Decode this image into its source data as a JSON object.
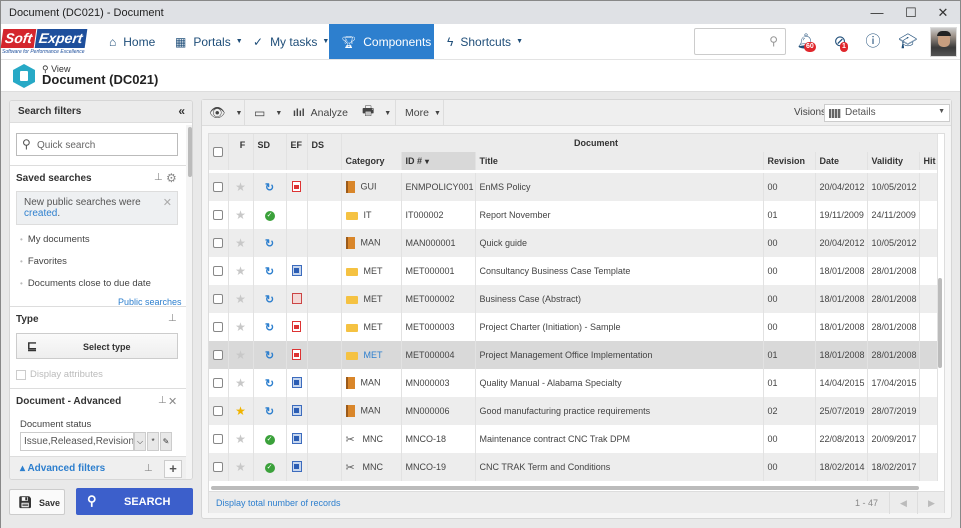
{
  "window": {
    "title": "Document (DC021) - Document",
    "minimize": "—",
    "maximize": "☐",
    "close": "✕"
  },
  "nav": {
    "logo_soft": "Soft",
    "logo_expert": "Expert",
    "logo_tagline": "Software for Performance Excellence",
    "items": [
      {
        "label": "Home",
        "icon": "home-icon"
      },
      {
        "label": "Portals",
        "icon": "portals-icon"
      },
      {
        "label": "My tasks",
        "icon": "check-icon"
      },
      {
        "label": "Components",
        "icon": "trophy-icon",
        "active": true
      },
      {
        "label": "Shortcuts",
        "icon": "bolt-icon"
      }
    ],
    "search_placeholder": "",
    "notifications_badge": "60",
    "tasks_badge": "1"
  },
  "page": {
    "view_label": "View",
    "title": "Document (DC021)"
  },
  "sidebar": {
    "title": "Search filters",
    "quick_search_placeholder": "Quick search",
    "saved_searches_title": "Saved searches",
    "notice_text": "New public searches were",
    "notice_link": "created",
    "saved_items": [
      "My documents",
      "Favorites",
      "Documents close to due date"
    ],
    "public_searches_link": "Public searches",
    "type_title": "Type",
    "select_type_label": "Select type",
    "display_attributes_label": "Display attributes",
    "advanced_title": "Document - Advanced",
    "doc_status_label": "Document status",
    "doc_status_value": "Issue,Released,Revision,In",
    "advanced_filters_label": "Advanced filters",
    "save_label": "Save",
    "search_label": "SEARCH"
  },
  "toolbar": {
    "analyze_label": "Analyze",
    "more_label": "More",
    "visions_label": "Visions:",
    "visions_value": "Details"
  },
  "table": {
    "group_header": "Document",
    "columns": {
      "f": "F",
      "sd": "SD",
      "ef": "EF",
      "ds": "DS",
      "category": "Category",
      "id": "ID #",
      "title": "Title",
      "revision": "Revision",
      "date": "Date",
      "validity": "Validity",
      "hit": "Hit"
    },
    "rows": [
      {
        "fav": false,
        "sd": "sync",
        "ef": "pdf",
        "cat_icon": "book",
        "category": "GUI",
        "id": "ENMPOLICY001",
        "title": "EnMS Policy",
        "revision": "00",
        "date": "20/04/2012",
        "validity": "10/05/2012"
      },
      {
        "fav": false,
        "sd": "ok",
        "ef": "",
        "cat_icon": "folder",
        "category": "IT",
        "id": "IT000002",
        "title": "Report November",
        "revision": "01",
        "date": "19/11/2009",
        "validity": "24/11/2009"
      },
      {
        "fav": false,
        "sd": "sync",
        "ef": "",
        "cat_icon": "book",
        "category": "MAN",
        "id": "MAN000001",
        "title": "Quick guide",
        "revision": "00",
        "date": "20/04/2012",
        "validity": "10/05/2012"
      },
      {
        "fav": false,
        "sd": "sync",
        "ef": "word",
        "cat_icon": "folder",
        "category": "MET",
        "id": "MET000001",
        "title": "Consultancy Business Case Template",
        "revision": "00",
        "date": "18/01/2008",
        "validity": "28/01/2008"
      },
      {
        "fav": false,
        "sd": "sync",
        "ef": "pres",
        "cat_icon": "folder",
        "category": "MET",
        "id": "MET000002",
        "title": "Business Case (Abstract)",
        "revision": "00",
        "date": "18/01/2008",
        "validity": "28/01/2008"
      },
      {
        "fav": false,
        "sd": "sync",
        "ef": "pdf",
        "cat_icon": "folder",
        "category": "MET",
        "id": "MET000003",
        "title": "Project Charter (Initiation) - Sample",
        "revision": "00",
        "date": "18/01/2008",
        "validity": "28/01/2008"
      },
      {
        "fav": false,
        "sd": "sync",
        "ef": "pdf",
        "cat_icon": "folder",
        "category": "MET",
        "id": "MET000004",
        "title": "Project Management Office Implementation",
        "revision": "01",
        "date": "18/01/2008",
        "validity": "28/01/2008",
        "selected": true
      },
      {
        "fav": false,
        "sd": "sync",
        "ef": "word",
        "cat_icon": "book",
        "category": "MAN",
        "id": "MN000003",
        "title": "Quality Manual - Alabama Specialty",
        "revision": "01",
        "date": "14/04/2015",
        "validity": "17/04/2015"
      },
      {
        "fav": true,
        "sd": "sync",
        "ef": "word",
        "cat_icon": "book",
        "category": "MAN",
        "id": "MN000006",
        "title": "Good manufacturing practice requirements",
        "revision": "02",
        "date": "25/07/2019",
        "validity": "28/07/2019"
      },
      {
        "fav": false,
        "sd": "ok",
        "ef": "word",
        "cat_icon": "tool",
        "category": "MNC",
        "id": "MNCO-18",
        "title": "Maintenance contract CNC Trak DPM",
        "revision": "00",
        "date": "22/08/2013",
        "validity": "20/09/2017"
      },
      {
        "fav": false,
        "sd": "ok",
        "ef": "word",
        "cat_icon": "tool",
        "category": "MNC",
        "id": "MNCO-19",
        "title": "CNC TRAK Term and Conditions",
        "revision": "00",
        "date": "18/02/2014",
        "validity": "18/02/2017"
      }
    ],
    "footer_link": "Display total number of records",
    "range": "1 - 47"
  }
}
